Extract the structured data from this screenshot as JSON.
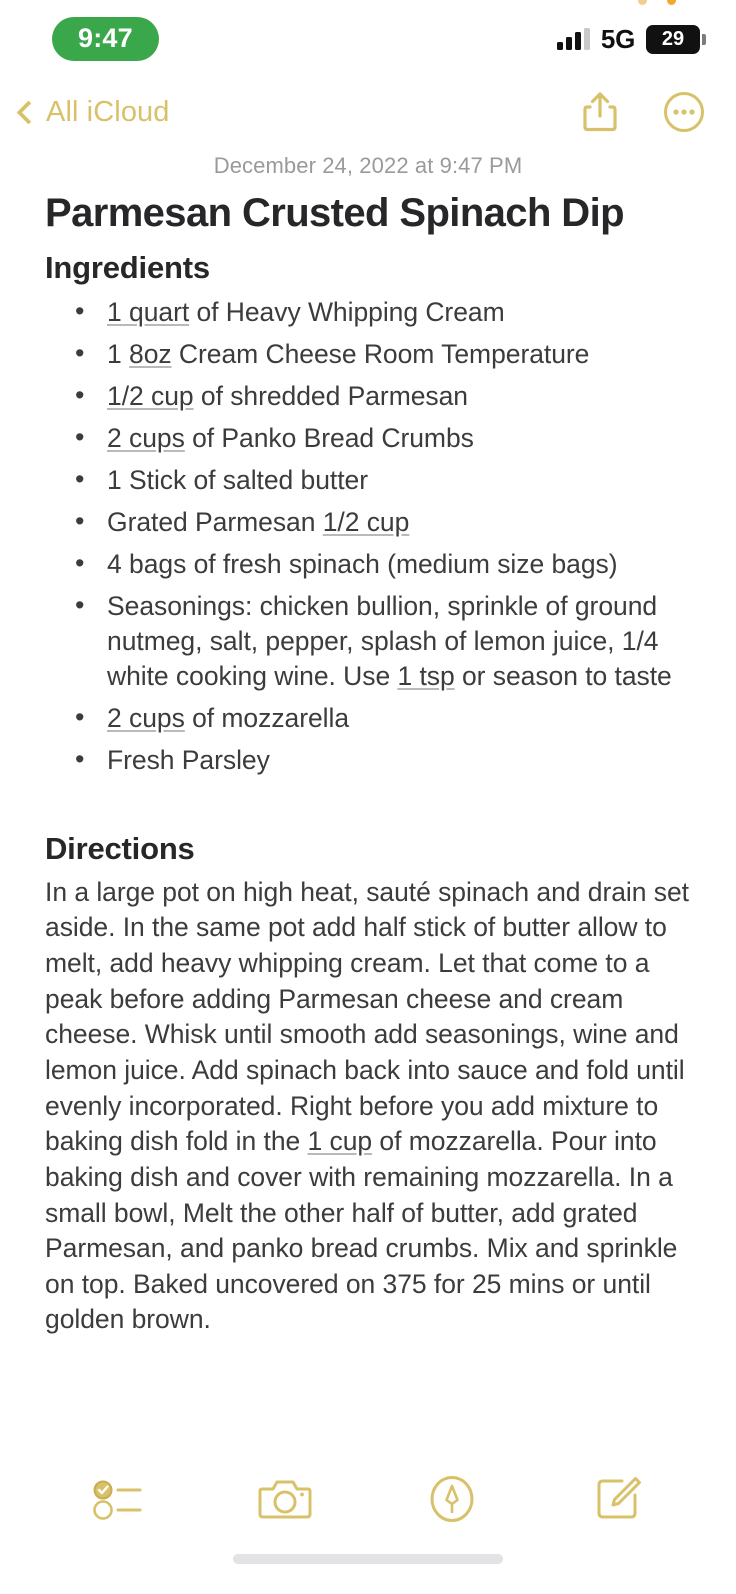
{
  "status_bar": {
    "recording_time": "9:47",
    "network": "5G",
    "battery_level": "29",
    "signal_icon": "cellular-bars-icon",
    "privacy_dot_icon": "privacy-indicator-dot"
  },
  "nav_bar": {
    "back_label": "All iCloud",
    "back_icon": "chevron-left-icon",
    "share_icon": "share-icon",
    "more_icon": "more-ellipsis-icon"
  },
  "note": {
    "date": "December 24, 2022 at 9:47 PM",
    "title": "Parmesan Crusted Spinach Dip",
    "ingredients_heading": "Ingredients",
    "ingredients": [
      {
        "measure": "1 quart",
        "rest": " of Heavy Whipping Cream"
      },
      {
        "lead": "1 ",
        "measure": "8oz",
        "rest": " Cream Cheese Room Temperature"
      },
      {
        "measure": "1/2 cup",
        "rest": " of shredded Parmesan"
      },
      {
        "measure": "2 cups",
        "rest": " of Panko Bread Crumbs"
      },
      {
        "lead": "1 Stick of salted butter"
      },
      {
        "lead": "Grated Parmesan ",
        "measure": "1/2 cup"
      },
      {
        "lead": "4 bags of fresh spinach (medium size bags)"
      },
      {
        "lead": "Seasonings: chicken bullion, sprinkle of ground nutmeg, salt, pepper, splash of lemon juice, 1/4 white cooking wine. Use ",
        "measure": "1 tsp",
        "rest": " or season to taste"
      },
      {
        "measure": "2 cups",
        "rest": " of mozzarella"
      },
      {
        "lead": "Fresh Parsley"
      }
    ],
    "directions_heading": "Directions",
    "directions_part1": "In a large pot on high heat, sauté spinach and drain set aside. In the same pot add half stick of butter allow to melt, add heavy whipping cream. Let that come to a peak before adding Parmesan cheese and cream cheese. Whisk until smooth add seasonings, wine and lemon juice. Add spinach back into sauce and fold until evenly incorporated. Right before you add mixture to baking dish fold in the ",
    "directions_measure": "1 cup",
    "directions_part2": " of mozzarella. Pour into baking dish and cover with remaining mozzarella. In a small bowl, Melt the other half of butter, add grated Parmesan, and panko bread crumbs. Mix and sprinkle on top. Baked uncovered on 375 for 25 mins or until golden brown."
  },
  "toolbar": {
    "checklist_icon": "checklist-icon",
    "camera_icon": "camera-icon",
    "markup_icon": "markup-pen-icon",
    "compose_icon": "compose-icon"
  },
  "colors": {
    "accent_gold": "#d8c169",
    "recording_green": "#3aa84a",
    "text_primary": "#3c3c3e",
    "text_heading": "#27272a",
    "text_muted": "#9a9a9d"
  }
}
